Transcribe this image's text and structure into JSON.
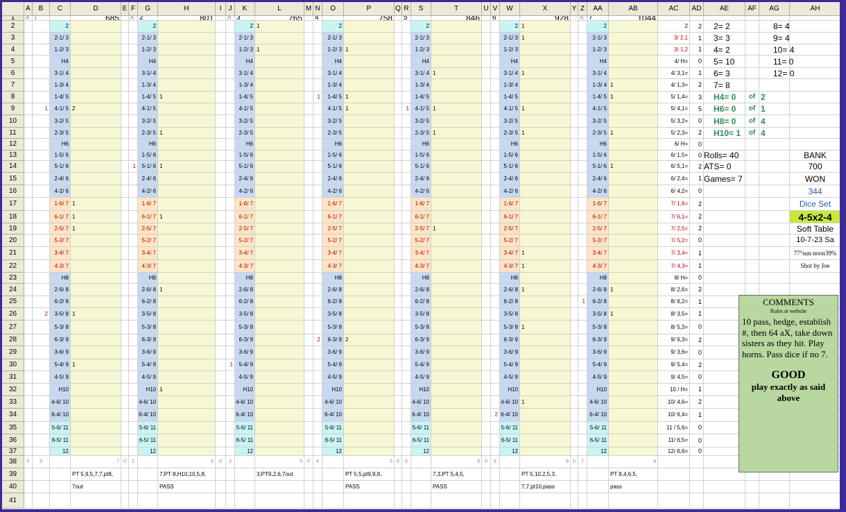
{
  "columns": [
    "A",
    "B",
    "C",
    "D",
    "E",
    "F",
    "G",
    "H",
    "I",
    "J",
    "K",
    "L",
    "M",
    "N",
    "O",
    "P",
    "Q",
    "R",
    "S",
    "T",
    "U",
    "V",
    "W",
    "X",
    "Y",
    "Z",
    "AA",
    "AB",
    "AC",
    "AD",
    "AE",
    "AF",
    "AG",
    "AH"
  ],
  "rows": [
    "1",
    "2",
    "3",
    "4",
    "5",
    "6",
    "7",
    "8",
    "9",
    "10",
    "11",
    "12",
    "13",
    "14",
    "15",
    "16",
    "17",
    "18",
    "19",
    "20",
    "21",
    "22",
    "23",
    "24",
    "25",
    "26",
    "27",
    "28",
    "29",
    "30",
    "31",
    "32",
    "33",
    "34",
    "35",
    "36",
    "37",
    "38",
    "39",
    "40",
    "41"
  ],
  "row1": {
    "A1": "A",
    "B1": "1",
    "D1": "685",
    "F1": "A",
    "G1": "2",
    "H1": "801",
    "J1": "A",
    "K1": "3",
    "L1": "765",
    "N1": "4",
    "P1": "758",
    "R1": "5",
    "T1": "846",
    "V1": "6",
    "X1": "928",
    "Z1": "A",
    "AA1": "7",
    "AB1": "1044"
  },
  "roll_labels": [
    "2",
    "2-1/ 3",
    "1-2/ 3",
    "H4",
    "3-1/ 4",
    "1-3/ 4",
    "1-4/ 5",
    "4-1/ 5",
    "3-2/ 5",
    "2-3/ 5",
    "H6",
    "1-5/ 6",
    "5-1/ 6",
    "2-4/ 6",
    "4-2/ 6",
    "1-6/ 7",
    "6-1/ 7",
    "2-5/ 7",
    "5-2/ 7",
    "3-4/ 7",
    "4-3/ 7",
    "H8",
    "2-6/ 8",
    "6-2/ 8",
    "3-5/ 8",
    "5-3/ 8",
    "6-3/ 9",
    "3-6/ 9",
    "5-4/ 9",
    "4-5/ 9",
    "H10",
    "4-6/ 10",
    "6-4/ 10",
    "5-6/ 11",
    "6-5/ 11",
    "12"
  ],
  "games": [
    {
      "counts": {
        "9": "2",
        "17": "1",
        "18": "1",
        "19": "1",
        "26": "1",
        "30": "1"
      },
      "markers": {
        "9": "1",
        "26": "2"
      },
      "row38": [
        "0",
        "3",
        "7"
      ],
      "pt_line1": "PT 5,9,5,7,7,pt8,",
      "pt_line2": "7out"
    },
    {
      "counts": {
        "8": "1",
        "11": "1",
        "14": "1",
        "18": "1",
        "24": "1",
        "32": "1"
      },
      "markers": {
        "14": "1"
      },
      "row38": [
        "0",
        "2",
        "6"
      ],
      "pt_line1": "7,PT 8,H10,10,5,8,",
      "pt_line2": "PASS"
    },
    {
      "counts": {
        "2": "1",
        "4": "1"
      },
      "markers": {
        "30": "1"
      },
      "row38": [
        "0",
        "3",
        "5"
      ],
      "pt_line1": "3,PT9,2,6,7out",
      "pt_line2": ""
    },
    {
      "counts": {
        "4": "1",
        "8": "1",
        "9": "1",
        "28": "2"
      },
      "markers": {
        "8": "1",
        "28": "2"
      },
      "row38": [
        "0",
        "4",
        "5"
      ],
      "pt_line1": "PT 5,5,pt9,9,8,",
      "pt_line2": "PASS"
    },
    {
      "counts": {
        "6": "1",
        "9": "1",
        "11": "1",
        "19": "1"
      },
      "markers": {
        "9": "1"
      },
      "row38": [
        "0",
        "5",
        "5"
      ],
      "pt_line1": "7,3,PT 5,4,5,",
      "pt_line2": "PASS"
    },
    {
      "counts": {
        "2": "1",
        "3": "1",
        "6": "1",
        "9": "1",
        "11": "1",
        "21": "1",
        "22": "1",
        "24": "1",
        "27": "1",
        "33": "1"
      },
      "markers": {
        "34": "2"
      },
      "row38": [
        "0",
        "6",
        "8"
      ],
      "pt_line1": "PT 5,10,2,5,3,",
      "pt_line2": "7,7,pt10,pass"
    },
    {
      "counts": {
        "7": "1",
        "8": "1",
        "11": "1",
        "14": "1",
        "24": "1",
        "26": "1"
      },
      "markers": {
        "25": "1"
      },
      "row38": [
        "0",
        "7",
        "4"
      ],
      "pt_line1": "PT 8,4,6,5,",
      "pt_line2": "pass"
    }
  ],
  "ac_labels": [
    "2",
    "3/ 2,1",
    "3/ 1,2",
    "4/ H=",
    "4/ 3,1=",
    "4/ 1,3=",
    "5/ 1,4=",
    "5/ 4,1=",
    "5/ 3,2=",
    "5/ 2,3=",
    "6/ H=",
    "6/ 1,5=",
    "6/ 5,1=",
    "6/ 2,4=",
    "6/ 4,2=",
    "7/ 1,6=",
    "7/ 6,1=",
    "7/ 2,5=",
    "7/ 5,2=",
    "7/ 3,4=",
    "7/ 4,3=",
    "8/ H=",
    "8/ 2,6=",
    "8/ 6,2=",
    "8/ 3,5=",
    "8/ 5,3=",
    "9/ 6,3=",
    "9/ 3,6=",
    "9/ 5,4=",
    "9/ 4,5=",
    "10 / H=",
    "10/ 4,6=",
    "10/ 6,4=",
    "11 / 5,6=",
    "11/ 6,5=",
    "12/ 6,6="
  ],
  "ad_values": [
    "2",
    "1",
    "1",
    "0",
    "1",
    "2",
    "3",
    "5",
    "0",
    "2",
    "0",
    "0",
    "2",
    "1",
    "0",
    "2",
    "2",
    "2",
    "0",
    "1",
    "1",
    "0",
    "2",
    "1",
    "1",
    "0",
    "2",
    "0",
    "2",
    "0",
    "1",
    "2",
    "1",
    "0",
    "0",
    "0"
  ],
  "summary": {
    "AE2": "2= 2",
    "AG2": "8= 4",
    "AE3": "3= 3",
    "AG3": "9= 4",
    "AE4": "4= 2",
    "AG4": "10= 4",
    "AE5": "5= 10",
    "AG5": "11= 0",
    "AE6": "6= 3",
    "AG6": "12= 0",
    "AE7": "7= 8",
    "AE8": "H4= 0",
    "AF8": "of",
    "AG8": "2",
    "AE9": "H6= 0",
    "AF9": "of",
    "AG9": "1",
    "AE10": "H8= 0",
    "AF10": "of",
    "AG10": "4",
    "AE11": "H10= 1",
    "AF11": "of",
    "AG11": "4",
    "AE13": "Rolls= 40",
    "AH13": "BANK",
    "AE14": "ATS= 0",
    "AH14": "700",
    "AE15": "Games= 7",
    "AH15": "WON",
    "AH16": "344",
    "AH17": "Dice Set",
    "AH18": "4-5x2-4",
    "AH19": "Soft Table",
    "AH20": "10-7-23  Sa",
    "AH21": "77°sun noon39%",
    "AH22": "Shot by Joe"
  },
  "comments": {
    "title": "COMMENTS",
    "rules": "Rules at website",
    "body": "10 pass, hedge, establish #, then 64 aX, take down sisters as they hit. Play horns. Pass dice if no 7.",
    "good": "GOOD",
    "play": "play exactly as said above"
  },
  "colors": {
    "blue_cell": "#c6d9f0",
    "yellow_cell": "#f7f7d4",
    "cyan_cell": "#c8f4f4",
    "orange_cell": "#fce4c4",
    "lime_cell": "#c6e83a",
    "green_text": "#2e8b57",
    "red_text": "#b00000",
    "header": "#ece9d8",
    "frame": "#3d2a98",
    "comment_bg": "#b9d7a0"
  }
}
